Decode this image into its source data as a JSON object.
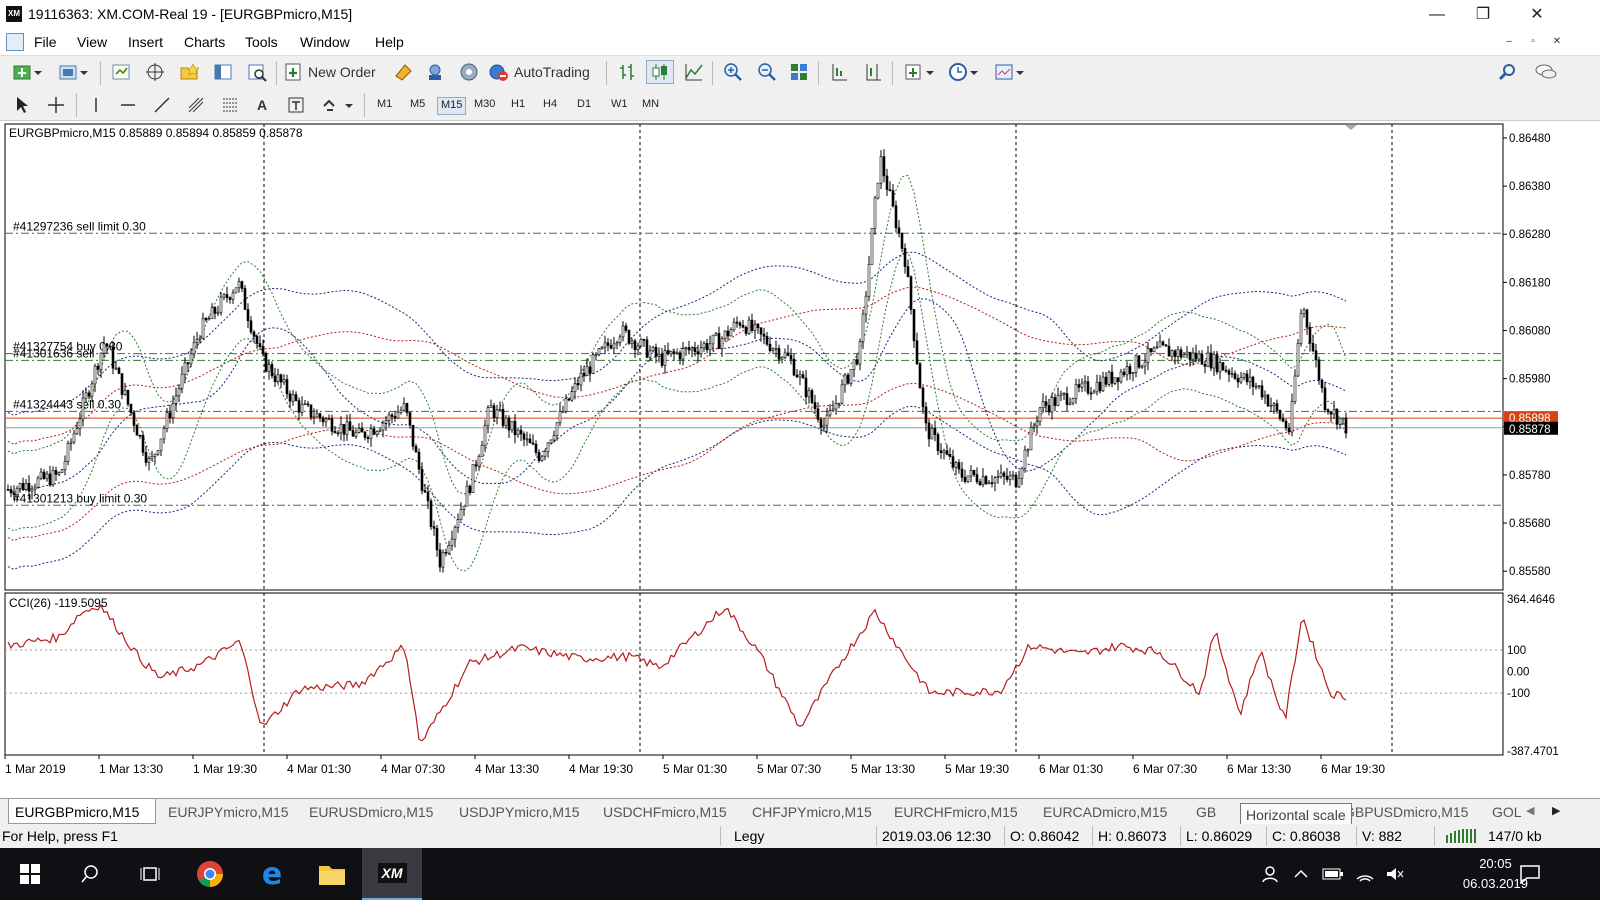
{
  "window": {
    "logo": "XM",
    "title": "19116363: XM.COM-Real 19 - [EURGBPmicro,M15]",
    "minimize": "—",
    "restore": "❐",
    "close": "✕"
  },
  "menu": [
    "File",
    "View",
    "Insert",
    "Charts",
    "Tools",
    "Window",
    "Help"
  ],
  "toolbar": {
    "new_order": "New Order",
    "autotrading": "AutoTrading"
  },
  "timeframes": [
    "M1",
    "M5",
    "M15",
    "M30",
    "H1",
    "H4",
    "D1",
    "W1",
    "MN"
  ],
  "active_timeframe": "M15",
  "chart": {
    "info": "EURGBPmicro,M15  0.85889 0.85894 0.85859 0.85878",
    "symbol": "EURGBPmicro",
    "period": "M15",
    "open": "0.85889",
    "high": "0.85894",
    "low": "0.85859",
    "close": "0.85878",
    "price_ticks": [
      "0.86480",
      "0.86380",
      "0.86280",
      "0.86180",
      "0.86080",
      "0.85980",
      "0.85880",
      "0.85780",
      "0.85680",
      "0.85580"
    ],
    "bid_label": "0.85898",
    "last_label": "0.85878",
    "orders": [
      {
        "label": "#41297236 sell limit 0.30",
        "price": 0.86282,
        "color": "#2e7d32"
      },
      {
        "label": "#41327754 buy 0.30",
        "price": 0.86032,
        "color": "#2e7d32"
      },
      {
        "label": "#41301636 sell",
        "price": 0.86018,
        "color": "#2e7d32"
      },
      {
        "label": "#41324443 sell 0.30",
        "price": 0.85912,
        "color": "#2e7d32"
      },
      {
        "label": "#41301213 buy limit 0.30",
        "price": 0.85717,
        "color": "#2e7d32"
      }
    ],
    "indicator": {
      "label": "CCI(26) -119.5095",
      "ticks": [
        "364.4646",
        "100",
        "0.00",
        "-100",
        "-387.4701"
      ],
      "top": 364.4646,
      "bottom": -387.4701
    },
    "time_labels": [
      "1 Mar 2019",
      "1 Mar 13:30",
      "1 Mar 19:30",
      "4 Mar 01:30",
      "4 Mar 07:30",
      "4 Mar 13:30",
      "4 Mar 19:30",
      "5 Mar 01:30",
      "5 Mar 07:30",
      "5 Mar 13:30",
      "5 Mar 19:30",
      "6 Mar 01:30",
      "6 Mar 07:30",
      "6 Mar 13:30",
      "6 Mar 19:30"
    ],
    "colors": {
      "bull_bear": "#000000",
      "cci": "#b71c1c",
      "grid": "#000000",
      "order": "#2e7d32",
      "bid": "#d84315"
    }
  },
  "tabs": [
    "EURGBPmicro,M15",
    "EURJPYmicro,M15",
    "EURUSDmicro,M15",
    "USDJPYmicro,M15",
    "USDCHFmicro,M15",
    "CHFJPYmicro,M15",
    "EURCHFmicro,M15",
    "EURCADmicro,M15",
    "GB",
    "GBPUSDmicro,M15",
    "GOL"
  ],
  "tooltip": "Horizontal scale",
  "status": {
    "help": "For Help, press F1",
    "profile": "Legy",
    "datetime": "2019.03.06 12:30",
    "open": "O: 0.86042",
    "high": "H: 0.86073",
    "low": "L: 0.86029",
    "close": "C: 0.86038",
    "volume": "V: 882",
    "traffic": "147/0 kb"
  },
  "taskbar": {
    "time": "20:05",
    "date": "06.03.2019"
  }
}
